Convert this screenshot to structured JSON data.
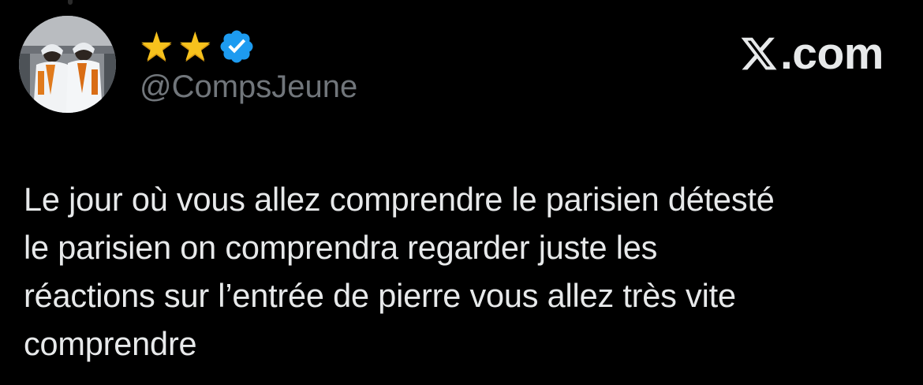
{
  "user": {
    "display_name": "⭐⭐",
    "stars": [
      "★",
      "★"
    ],
    "verified_icon": "verified-badge-icon",
    "handle": "@CompsJeune",
    "avatar": "profile-photo"
  },
  "brand": {
    "label": ".com",
    "icon": "x-logo-icon"
  },
  "tweet": {
    "text": "Le jour où vous allez comprendre le parisien détesté\nle parisien on comprendra regarder juste les\nréactions sur l’entrée de pierre vous allez très vite\ncomprendre"
  },
  "colors": {
    "background": "#000000",
    "text": "#e7e9ea",
    "secondary_text": "#71767b",
    "verified_blue": "#1d9bf0",
    "star_yellow": "#f7c21d"
  }
}
